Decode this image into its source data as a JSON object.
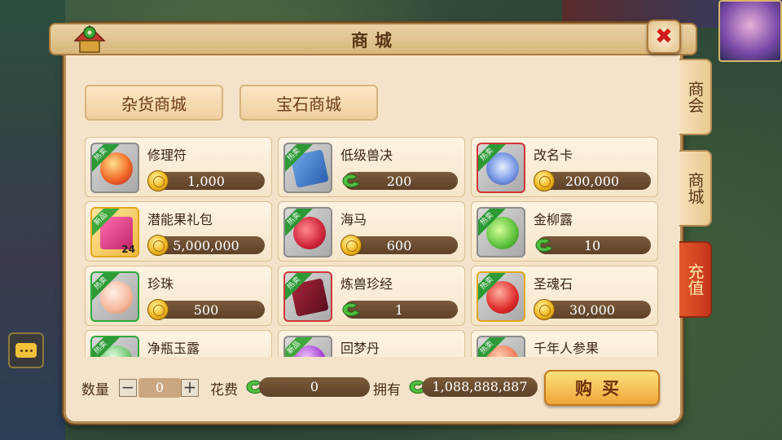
{
  "window": {
    "title": "商城"
  },
  "tabs": [
    {
      "label": "杂货商城"
    },
    {
      "label": "宝石商城"
    }
  ],
  "side_tabs": [
    {
      "label": "商会"
    },
    {
      "label": "商城"
    },
    {
      "label": "充值"
    }
  ],
  "items": [
    {
      "name": "修理符",
      "price": "1,000",
      "currency": "gold-coin-icon",
      "badge": "热卖",
      "frame": "gray"
    },
    {
      "name": "低级兽决",
      "price": "200",
      "currency": "jade-coin-icon",
      "badge": "热卖",
      "frame": "gray"
    },
    {
      "name": "改名卡",
      "price": "200,000",
      "currency": "gold-coin-icon",
      "badge": "热卖",
      "frame": "red"
    },
    {
      "name": "潜能果礼包",
      "price": "5,000,000",
      "currency": "gold-coin-icon",
      "badge": "新品",
      "frame": "gold",
      "qty": "24"
    },
    {
      "name": "海马",
      "price": "600",
      "currency": "gold-coin-icon",
      "badge": "热卖",
      "frame": "gray"
    },
    {
      "name": "金柳露",
      "price": "10",
      "currency": "jade-coin-icon",
      "badge": "热卖",
      "frame": "gray"
    },
    {
      "name": "珍珠",
      "price": "500",
      "currency": "gold-coin-icon",
      "badge": "热卖",
      "frame": "green"
    },
    {
      "name": "炼兽珍经",
      "price": "1",
      "currency": "jade-coin-icon",
      "badge": "热卖",
      "frame": "red"
    },
    {
      "name": "圣魂石",
      "price": "30,000",
      "currency": "gold-coin-icon",
      "badge": "热卖",
      "frame": "gold"
    },
    {
      "name": "净瓶玉露",
      "price": "",
      "currency": "",
      "badge": "热卖",
      "frame": "green"
    },
    {
      "name": "回梦丹",
      "price": "",
      "currency": "",
      "badge": "新品",
      "frame": "gray"
    },
    {
      "name": "千年人参果",
      "price": "",
      "currency": "",
      "badge": "热卖",
      "frame": "gray"
    }
  ],
  "footer": {
    "quantity_label": "数量",
    "quantity_value": "0",
    "minus": "−",
    "plus": "+",
    "cost_label": "花费",
    "cost_value": "0",
    "own_label": "拥有",
    "own_value": "1,088,888,887",
    "buy_label": "购买"
  },
  "colors": {
    "accent": "#f0a63a",
    "panel": "#f4e3c8",
    "frame_border": "#b48a52"
  }
}
